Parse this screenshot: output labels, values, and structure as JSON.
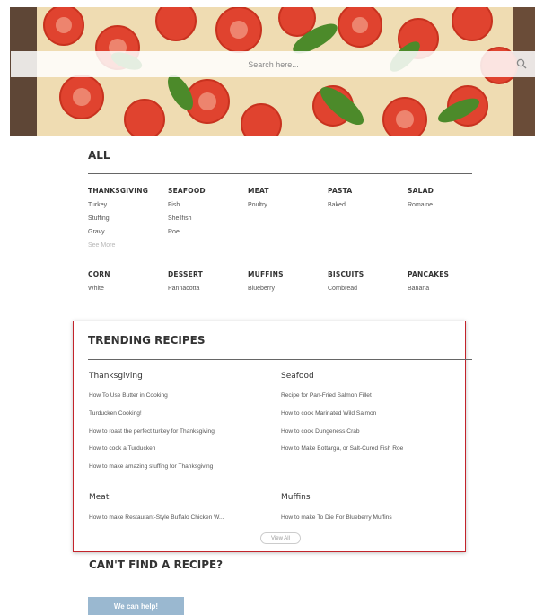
{
  "search": {
    "placeholder": "Search here..."
  },
  "all_section": {
    "title": "ALL",
    "categories": [
      {
        "title": "THANKSGIVING",
        "items": [
          "Turkey",
          "Stuffing",
          "Gravy"
        ],
        "see_more": "See More"
      },
      {
        "title": "SEAFOOD",
        "items": [
          "Fish",
          "Shellfish",
          "Roe"
        ]
      },
      {
        "title": "MEAT",
        "items": [
          "Poultry"
        ]
      },
      {
        "title": "PASTA",
        "items": [
          "Baked"
        ]
      },
      {
        "title": "SALAD",
        "items": [
          "Romaine"
        ]
      },
      {
        "title": "CORN",
        "items": [
          "White"
        ]
      },
      {
        "title": "DESSERT",
        "items": [
          "Pannacotta"
        ]
      },
      {
        "title": "MUFFINS",
        "items": [
          "Blueberry"
        ]
      },
      {
        "title": "BISCUITS",
        "items": [
          "Cornbread"
        ]
      },
      {
        "title": "PANCAKES",
        "items": [
          "Banana"
        ]
      }
    ]
  },
  "trending": {
    "title": "TRENDING RECIPES",
    "groups": [
      {
        "title": "Thanksgiving",
        "links": [
          "How To Use Butter in Cooking",
          "Turducken Cooking!",
          "How to roast the perfect turkey for Thanksgiving",
          "How to cook a Turducken",
          "How to make amazing stuffing for Thanksgiving"
        ]
      },
      {
        "title": "Seafood",
        "links": [
          "Recipe for Pan-Fried Salmon Fillet",
          "How to cook Marinated Wild Salmon",
          "How to cook Dungeness Crab",
          "How to Make Bottarga, or Salt-Cured Fish Roe"
        ]
      },
      {
        "title": "Meat",
        "links": [
          "How to make Restaurant-Style Buffalo Chicken W..."
        ]
      },
      {
        "title": "Muffins",
        "links": [
          "How to make To Die For Blueberry Muffins"
        ]
      }
    ],
    "view_all": "View All"
  },
  "cant_find": {
    "title": "CAN'T FIND A RECIPE?",
    "button": "We can help!"
  },
  "colors": {
    "highlight_border": "#c3242b",
    "help_button": "#9ab8d0"
  },
  "icons": {
    "search": "search-icon"
  }
}
